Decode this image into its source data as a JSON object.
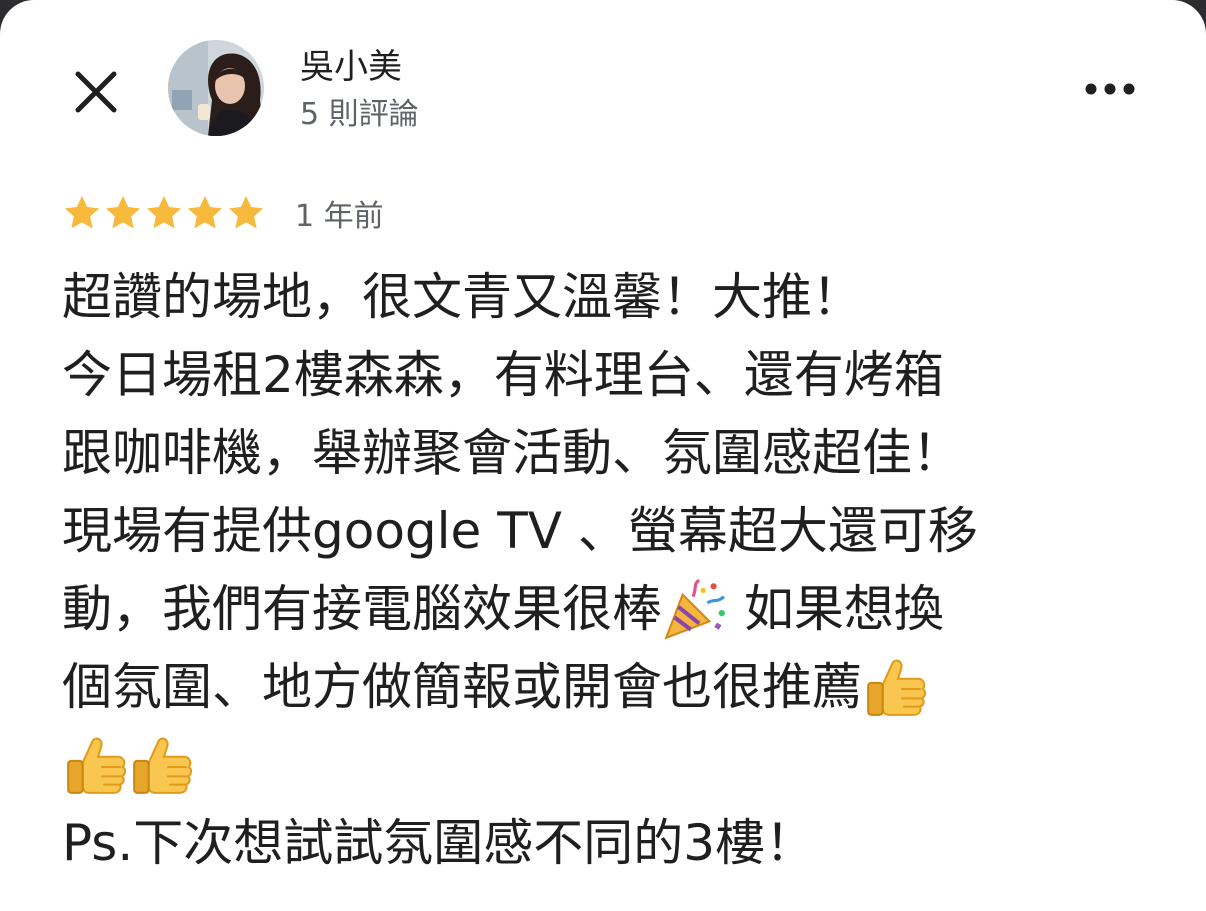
{
  "header": {
    "close_icon": "close-icon",
    "more_icon": "more-horizontal-icon"
  },
  "reviewer": {
    "name": "吳小美",
    "review_count": "5 則評論"
  },
  "review": {
    "rating": 5,
    "rating_max": 5,
    "star_color": "#F6B93B",
    "time": "1 年前",
    "lines": [
      {
        "text": "超讚的場地，很文青又溫馨！大推！",
        "emoji": ""
      },
      {
        "text": "今日場租2樓森森，有料理台、還有烤箱",
        "emoji": ""
      },
      {
        "text": "跟咖啡機，舉辦聚會活動、氛圍感超佳！",
        "emoji": ""
      },
      {
        "text": "現場有提供google TV 、螢幕超大還可移",
        "emoji": ""
      },
      {
        "text": "動，我們有接電腦效果很棒",
        "emoji": "party-popper-icon",
        "text_after": " 如果想換"
      },
      {
        "text": "個氛圍、地方做簡報或開會也很推薦",
        "emoji": "thumbs-up-icon"
      },
      {
        "text": "",
        "emoji": "thumbs-up-icon",
        "emoji_count": 2
      },
      {
        "text": "Ps.下次想試試氛圍感不同的3樓！",
        "emoji": ""
      }
    ]
  }
}
